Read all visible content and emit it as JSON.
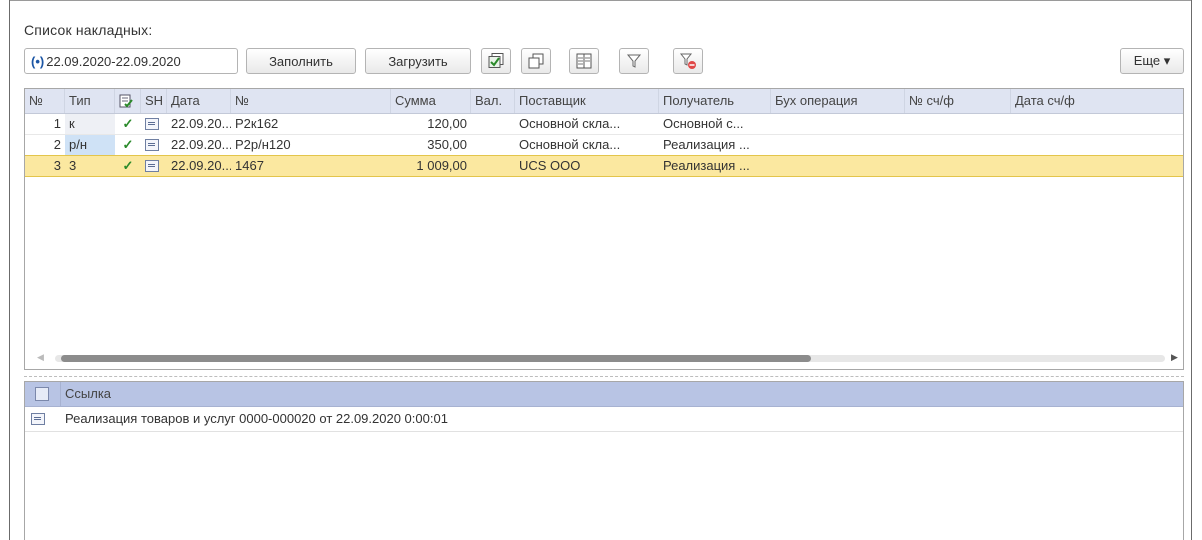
{
  "panel": {
    "title": "Список накладных:"
  },
  "toolbar": {
    "period": "22.09.2020-22.09.2020",
    "period_icon": "(•)",
    "fill_label": "Заполнить",
    "load_label": "Загрузить",
    "more_label": "Еще ▾"
  },
  "table": {
    "headers": [
      "№",
      "Тип",
      "",
      "SH",
      "Дата",
      "№",
      "Сумма",
      "Вал.",
      "Поставщик",
      "Получатель",
      "Бух операция",
      "№ сч/ф",
      "Дата сч/ф"
    ],
    "rows": [
      {
        "n": "1",
        "type": "к",
        "checked": "✓",
        "date": "22.09.20...",
        "doc": "Р2к162",
        "sum": "120,00",
        "cur": "",
        "supplier": "Основной скла...",
        "receiver": "Основной с..."
      },
      {
        "n": "2",
        "type": "р/н",
        "checked": "✓",
        "date": "22.09.20...",
        "doc": "Р2р/н120",
        "sum": "350,00",
        "cur": "",
        "supplier": "Основной скла...",
        "receiver": "Реализация ..."
      },
      {
        "n": "3",
        "type": "3",
        "checked": "✓",
        "date": "22.09.20...",
        "doc": "1467",
        "sum": "1 009,00",
        "cur": "",
        "supplier": "UCS OOO",
        "receiver": "Реализация ..."
      }
    ],
    "selected_row": 3
  },
  "links": {
    "header": "Ссылка",
    "rows": [
      {
        "text": "Реализация товаров и услуг 0000-000020 от 22.09.2020 0:00:01"
      }
    ]
  },
  "colors": {
    "selected": "#fbe8a0",
    "header": "#dfe4f2",
    "link_header": "#b8c4e4"
  }
}
